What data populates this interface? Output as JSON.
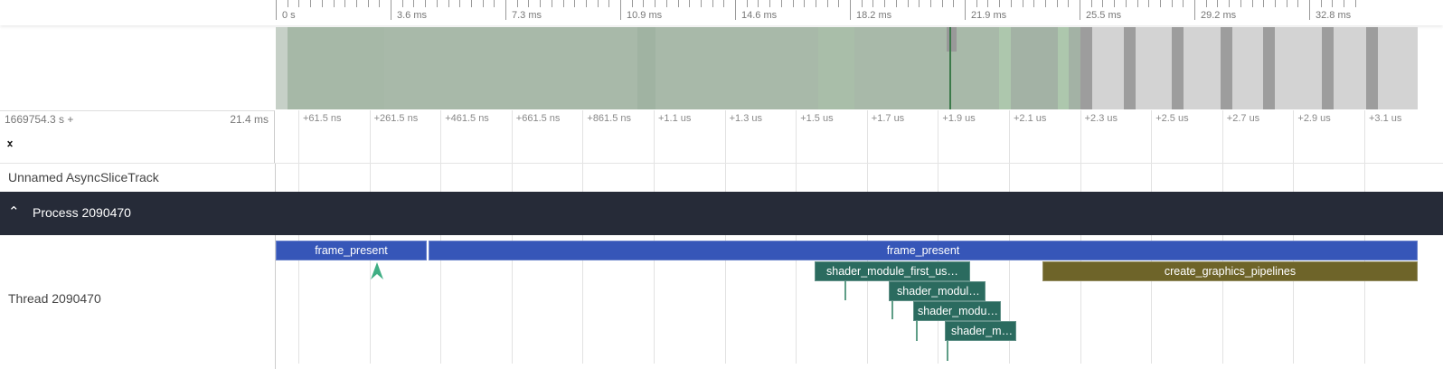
{
  "ruler": {
    "labels": [
      "0 s",
      "3.6 ms",
      "7.3 ms",
      "10.9 ms",
      "14.6 ms",
      "18.2 ms",
      "21.9 ms",
      "25.5 ms",
      "29.2 ms",
      "32.8 ms"
    ]
  },
  "timeline": {
    "offset": "1669754.3 s +",
    "span": "21.4 ms",
    "labels": [
      "+61.5 ns",
      "+261.5 ns",
      "+461.5 ns",
      "+661.5 ns",
      "+861.5 ns",
      "+1.1 us",
      "+1.3 us",
      "+1.5 us",
      "+1.7 us",
      "+1.9 us",
      "+2.1 us",
      "+2.3 us",
      "+2.5 us",
      "+2.7 us",
      "+2.9 us",
      "+3.1 us"
    ]
  },
  "tracks": {
    "async": "Unnamed AsyncSliceTrack",
    "process": "Process 2090470",
    "thread": "Thread 2090470"
  },
  "slices": [
    "frame_present",
    "frame_present",
    "shader_module_first_us…",
    "shader_modul…",
    "shader_modu…",
    "shader_m…",
    "create_graphics_pipelines"
  ],
  "colors": {
    "frame": "#3656b8",
    "shader": "#2b6b5f",
    "pipelines": "#6e6429",
    "process_bg": "#262b38"
  }
}
